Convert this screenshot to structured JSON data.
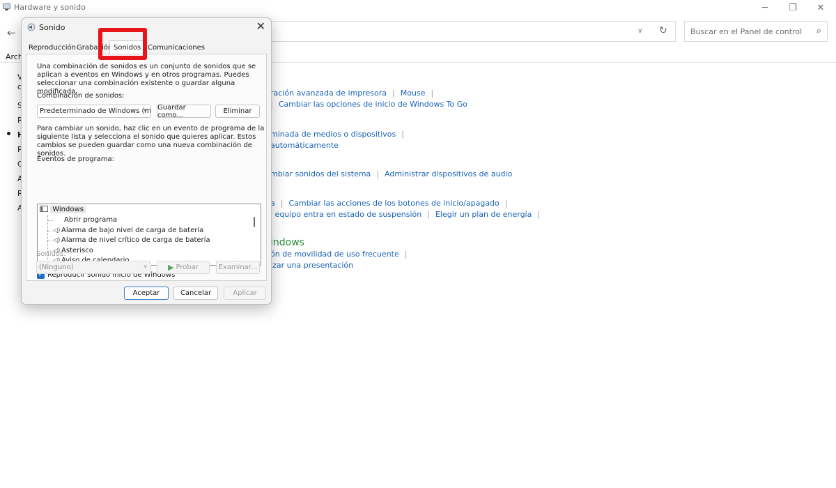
{
  "window": {
    "title": "Hardware y sonido",
    "search_placeholder": "Buscar en el Panel de control",
    "menu_partial": "Arch"
  },
  "left_nav": [
    "V",
    "c",
    "S",
    "R",
    "H",
    "P",
    "C",
    "A",
    "R",
    "A"
  ],
  "links": [
    {
      "items": [
        "ración avanzada de impresora",
        "Mouse"
      ]
    },
    {
      "items": [
        "",
        "Cambiar las opciones de inicio de Windows To Go"
      ]
    },
    {
      "items": [
        "minada de medios o dispositivos"
      ]
    },
    {
      "items": [
        "automáticamente"
      ]
    },
    {
      "items": [
        "mbiar sonidos del sistema",
        "Administrar dispositivos de audio"
      ]
    },
    {
      "items": [
        "a",
        "Cambiar las acciones de los botones de inicio/apagado"
      ]
    },
    {
      "items": [
        "l equipo entra en estado de suspensión",
        "Elegir un plan de energía"
      ]
    },
    {
      "items": [
        "ón de movilidad de uso frecuente"
      ]
    },
    {
      "items": [
        "izar una presentación"
      ]
    }
  ],
  "green_heading": "indows",
  "dialog": {
    "title": "Sonido",
    "tabs": [
      "Reproducción",
      "Grabación",
      "Sonidos",
      "Comunicaciones"
    ],
    "active_tab": "Sonidos",
    "intro_lines": [
      "Una combinación de sonidos es un conjunto de sonidos que se",
      "aplican a eventos en Windows y en otros programas. Puedes",
      "seleccionar una combinación existente o guardar alguna modificada."
    ],
    "scheme_label": "Combinación de sonidos:",
    "scheme_value": "Predeterminado de Windows (m",
    "save_as_label": "Guardar como...",
    "delete_label": "Eliminar",
    "help_lines": [
      "Para cambiar un sonido, haz clic en un evento de programa de la",
      "siguiente lista y selecciona el sonido que quieres aplicar. Estos",
      "cambios se pueden guardar como una nueva combinación de sonidos."
    ],
    "events_label": "Eventos de programa:",
    "events_root": "Windows",
    "events": [
      {
        "label": "Abrir programa",
        "has_sound": false
      },
      {
        "label": "Alarma de bajo nivel de carga de batería",
        "has_sound": true
      },
      {
        "label": "Alarma de nivel crítico de carga de batería",
        "has_sound": true
      },
      {
        "label": "Asterisco",
        "has_sound": true
      },
      {
        "label": "Aviso de calendario",
        "has_sound": true
      }
    ],
    "startup_checkbox_label": "Reproducir sonido Inicio de Windows",
    "startup_checked": true,
    "sounds_label": "Sonidos:",
    "sound_value": "(Ninguno)",
    "test_label": "Probar",
    "browse_label": "Examinar...",
    "ok_label": "Aceptar",
    "cancel_label": "Cancelar",
    "apply_label": "Aplicar"
  },
  "colors": {
    "link": "#1a63b5",
    "highlight": "#e8141b",
    "accent": "#1f6fc6",
    "green_heading": "#2a8a3e"
  }
}
